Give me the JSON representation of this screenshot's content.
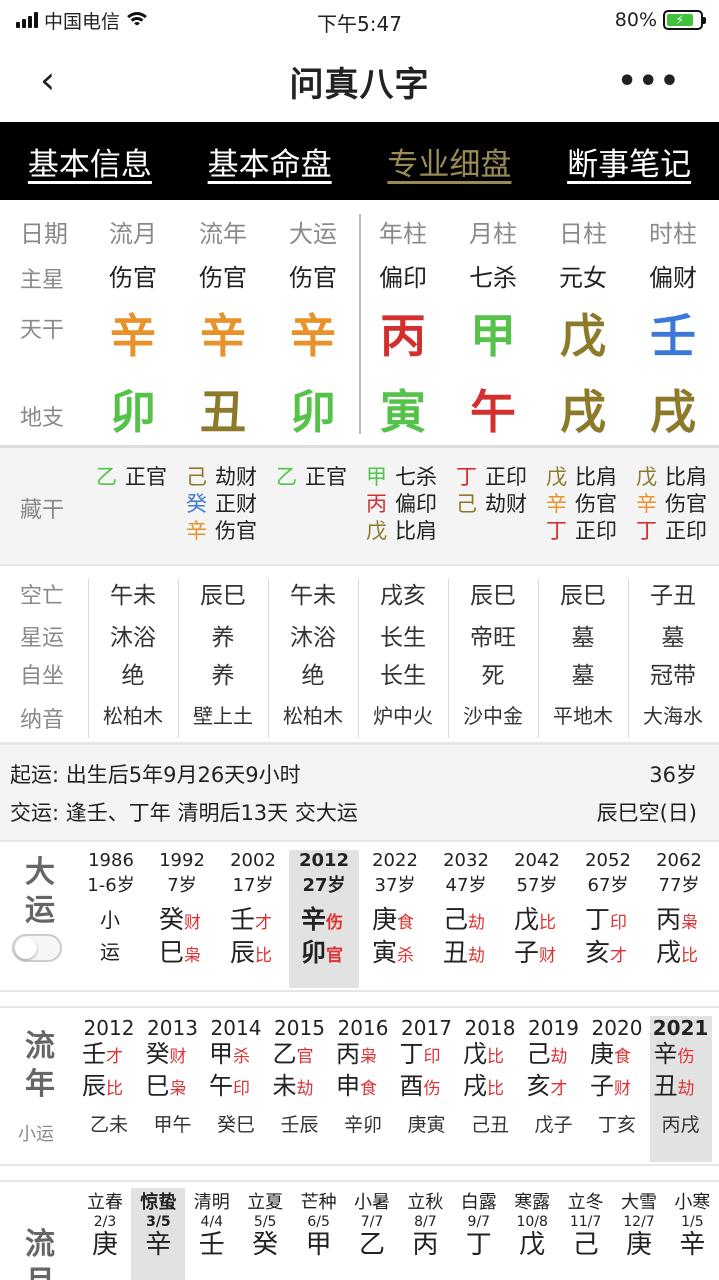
{
  "status": {
    "carrier": "中国电信",
    "time": "下午5:47",
    "battery": "80%"
  },
  "nav": {
    "title": "问真八字"
  },
  "tabs": [
    {
      "label": "基本信息"
    },
    {
      "label": "基本命盘"
    },
    {
      "label": "专业细盘"
    },
    {
      "label": "断事笔记"
    }
  ],
  "chart": {
    "headers": [
      "日期",
      "流月",
      "流年",
      "大运",
      "年柱",
      "月柱",
      "日柱",
      "时柱"
    ],
    "row_labels": {
      "star": "主星",
      "stem": "天干",
      "branch": "地支",
      "hidden": "藏干"
    },
    "stars": [
      "伤官",
      "伤官",
      "伤官",
      "偏印",
      "七杀",
      "元女",
      "偏财"
    ],
    "stems": [
      {
        "c": "辛",
        "col": "#e8922b"
      },
      {
        "c": "辛",
        "col": "#e8922b"
      },
      {
        "c": "辛",
        "col": "#e8922b"
      },
      {
        "c": "丙",
        "col": "#d32f2f"
      },
      {
        "c": "甲",
        "col": "#55c24a"
      },
      {
        "c": "戊",
        "col": "#8c7a2a"
      },
      {
        "c": "壬",
        "col": "#3c78d8"
      }
    ],
    "branches": [
      {
        "c": "卯",
        "col": "#55c24a"
      },
      {
        "c": "丑",
        "col": "#8c7a2a"
      },
      {
        "c": "卯",
        "col": "#55c24a"
      },
      {
        "c": "寅",
        "col": "#55c24a"
      },
      {
        "c": "午",
        "col": "#d32f2f"
      },
      {
        "c": "戌",
        "col": "#8c7a2a"
      },
      {
        "c": "戌",
        "col": "#8c7a2a"
      }
    ]
  },
  "hidden_stems": [
    [
      {
        "s": "乙",
        "c": "#55c24a",
        "g": "正官"
      }
    ],
    [
      {
        "s": "己",
        "c": "#8c7a2a",
        "g": "劫财"
      },
      {
        "s": "癸",
        "c": "#3c78d8",
        "g": "正财"
      },
      {
        "s": "辛",
        "c": "#e8922b",
        "g": "伤官"
      }
    ],
    [
      {
        "s": "乙",
        "c": "#55c24a",
        "g": "正官"
      }
    ],
    [
      {
        "s": "甲",
        "c": "#55c24a",
        "g": "七杀"
      },
      {
        "s": "丙",
        "c": "#d32f2f",
        "g": "偏印"
      },
      {
        "s": "戊",
        "c": "#8c7a2a",
        "g": "比肩"
      }
    ],
    [
      {
        "s": "丁",
        "c": "#d32f2f",
        "g": "正印"
      },
      {
        "s": "己",
        "c": "#8c7a2a",
        "g": "劫财"
      }
    ],
    [
      {
        "s": "戊",
        "c": "#8c7a2a",
        "g": "比肩"
      },
      {
        "s": "辛",
        "c": "#e8922b",
        "g": "伤官"
      },
      {
        "s": "丁",
        "c": "#d32f2f",
        "g": "正印"
      }
    ],
    [
      {
        "s": "戊",
        "c": "#8c7a2a",
        "g": "比肩"
      },
      {
        "s": "辛",
        "c": "#e8922b",
        "g": "伤官"
      },
      {
        "s": "丁",
        "c": "#d32f2f",
        "g": "正印"
      }
    ]
  ],
  "info": {
    "labels": [
      "空亡",
      "星运",
      "自坐",
      "纳音"
    ],
    "rows": [
      [
        "午未",
        "辰巳",
        "午未",
        "戌亥",
        "辰巳",
        "辰巳",
        "子丑"
      ],
      [
        "沐浴",
        "养",
        "沐浴",
        "长生",
        "帝旺",
        "墓",
        "墓"
      ],
      [
        "绝",
        "养",
        "绝",
        "长生",
        "死",
        "墓",
        "冠带"
      ],
      [
        "松柏木",
        "壁上土",
        "松柏木",
        "炉中火",
        "沙中金",
        "平地木",
        "大海水"
      ]
    ]
  },
  "summary": {
    "qiyun_label": "起运:",
    "qiyun": "出生后5年9月26天9小时",
    "age": "36岁",
    "jiaoyun_label": "交运:",
    "jiaoyun": "逢壬、丁年 清明后13天 交大运",
    "kong": "辰巳空(日)"
  },
  "dayun": {
    "label": "大运",
    "cols": [
      {
        "y": "1986",
        "a": "1-6岁",
        "g1": "小",
        "g2": "运",
        "s1": "",
        "s2": ""
      },
      {
        "y": "1992",
        "a": "7岁",
        "g1": "癸",
        "s1": "财",
        "g2": "巳",
        "s2": "枭"
      },
      {
        "y": "2002",
        "a": "17岁",
        "g1": "壬",
        "s1": "才",
        "g2": "辰",
        "s2": "比"
      },
      {
        "y": "2012",
        "a": "27岁",
        "g1": "辛",
        "s1": "伤",
        "g2": "卯",
        "s2": "官",
        "sel": true
      },
      {
        "y": "2022",
        "a": "37岁",
        "g1": "庚",
        "s1": "食",
        "g2": "寅",
        "s2": "杀"
      },
      {
        "y": "2032",
        "a": "47岁",
        "g1": "己",
        "s1": "劫",
        "g2": "丑",
        "s2": "劫"
      },
      {
        "y": "2042",
        "a": "57岁",
        "g1": "戊",
        "s1": "比",
        "g2": "子",
        "s2": "财"
      },
      {
        "y": "2052",
        "a": "67岁",
        "g1": "丁",
        "s1": "印",
        "g2": "亥",
        "s2": "才"
      },
      {
        "y": "2062",
        "a": "77岁",
        "g1": "丙",
        "s1": "枭",
        "g2": "戌",
        "s2": "比"
      }
    ]
  },
  "liunian": {
    "label": "流年",
    "sub": "小运",
    "cols": [
      {
        "y": "2012",
        "g1": "壬",
        "s1": "才",
        "g2": "辰",
        "s2": "比",
        "x": "乙未"
      },
      {
        "y": "2013",
        "g1": "癸",
        "s1": "财",
        "g2": "巳",
        "s2": "枭",
        "x": "甲午"
      },
      {
        "y": "2014",
        "g1": "甲",
        "s1": "杀",
        "g2": "午",
        "s2": "印",
        "x": "癸巳"
      },
      {
        "y": "2015",
        "g1": "乙",
        "s1": "官",
        "g2": "未",
        "s2": "劫",
        "x": "壬辰"
      },
      {
        "y": "2016",
        "g1": "丙",
        "s1": "枭",
        "g2": "申",
        "s2": "食",
        "x": "辛卯"
      },
      {
        "y": "2017",
        "g1": "丁",
        "s1": "印",
        "g2": "酉",
        "s2": "伤",
        "x": "庚寅"
      },
      {
        "y": "2018",
        "g1": "戊",
        "s1": "比",
        "g2": "戌",
        "s2": "比",
        "x": "己丑"
      },
      {
        "y": "2019",
        "g1": "己",
        "s1": "劫",
        "g2": "亥",
        "s2": "才",
        "x": "戊子"
      },
      {
        "y": "2020",
        "g1": "庚",
        "s1": "食",
        "g2": "子",
        "s2": "财",
        "x": "丁亥"
      },
      {
        "y": "2021",
        "g1": "辛",
        "s1": "伤",
        "g2": "丑",
        "s2": "劫",
        "x": "丙戌",
        "sel": true
      }
    ]
  },
  "liuyue": {
    "label": "流月",
    "cols": [
      {
        "t": "立春",
        "d": "2/3",
        "g": "庚"
      },
      {
        "t": "惊蛰",
        "d": "3/5",
        "g": "辛",
        "sel": true
      },
      {
        "t": "清明",
        "d": "4/4",
        "g": "壬"
      },
      {
        "t": "立夏",
        "d": "5/5",
        "g": "癸"
      },
      {
        "t": "芒种",
        "d": "6/5",
        "g": "甲"
      },
      {
        "t": "小暑",
        "d": "7/7",
        "g": "乙"
      },
      {
        "t": "立秋",
        "d": "8/7",
        "g": "丙"
      },
      {
        "t": "白露",
        "d": "9/7",
        "g": "丁"
      },
      {
        "t": "寒露",
        "d": "10/8",
        "g": "戊"
      },
      {
        "t": "立冬",
        "d": "11/7",
        "g": "己"
      },
      {
        "t": "大雪",
        "d": "12/7",
        "g": "庚"
      },
      {
        "t": "小寒",
        "d": "1/5",
        "g": "辛"
      }
    ]
  }
}
